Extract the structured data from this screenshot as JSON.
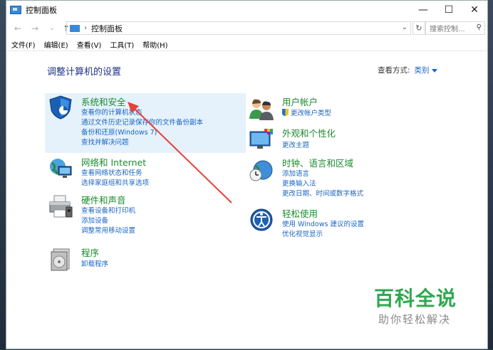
{
  "window": {
    "title": "控制面板",
    "minimize": "—",
    "maximize": "☐",
    "close": "✕"
  },
  "nav": {
    "address": "控制面板",
    "search_placeholder": "搜索控制...",
    "back_icon": "arrow-left",
    "forward_icon": "arrow-right",
    "up_icon": "arrow-up"
  },
  "menu": [
    {
      "label": "文件(F)"
    },
    {
      "label": "编辑(E)"
    },
    {
      "label": "查看(V)"
    },
    {
      "label": "工具(T)"
    },
    {
      "label": "帮助(H)"
    }
  ],
  "main": {
    "title": "调整计算机的设置",
    "view_by_label": "查看方式:",
    "view_by_value": "类别"
  },
  "categories": [
    {
      "title": "系统和安全",
      "links": [
        "查看你的计算机状态",
        "通过文件历史记录保存你的文件备份副本",
        "备份和还原(Windows 7)",
        "查找并解决问题"
      ]
    },
    {
      "title": "网络和 Internet",
      "links": [
        "查看网络状态和任务",
        "选择家庭组和共享选项"
      ]
    },
    {
      "title": "硬件和声音",
      "links": [
        "查看设备和打印机",
        "添加设备",
        "调整常用移动设置"
      ]
    },
    {
      "title": "程序",
      "links": [
        "卸载程序"
      ]
    },
    {
      "title": "用户帐户",
      "links": [
        "更改帐户类型"
      ]
    },
    {
      "title": "外观和个性化",
      "links": [
        "更改主题"
      ]
    },
    {
      "title": "时钟、语言和区域",
      "links": [
        "添加语言",
        "更换输入法",
        "更改日期、时间或数字格式"
      ]
    },
    {
      "title": "轻松使用",
      "links": [
        "使用 Windows 建议的设置",
        "优化视觉显示"
      ]
    }
  ],
  "watermark": {
    "title": "百科全说",
    "subtitle": "助你轻松解决"
  },
  "colors": {
    "category_title": "#1c8a2e",
    "link": "#1a66c4",
    "page_title": "#1e3287",
    "highlight": "#e5f1fb",
    "arrow": "#e8413a"
  }
}
